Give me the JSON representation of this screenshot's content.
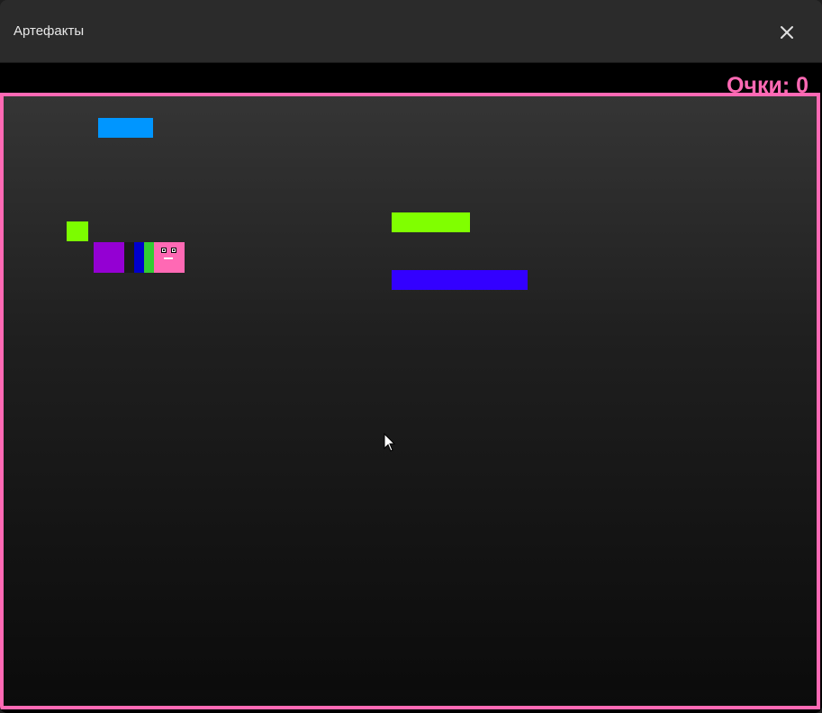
{
  "window": {
    "title": "Артефакты",
    "close_icon": "close-icon"
  },
  "game": {
    "score_text": "Очки: 0",
    "score_label": "Очки",
    "score_value": 0,
    "colors": {
      "accent": "#ff69b4",
      "snake_head": "#ff69b4",
      "snake_segments": [
        "#9400d3",
        "#0000cd",
        "#32cd32"
      ],
      "food_green": "#7cfc00",
      "platform_blue": "#0096ff",
      "platform_lime": "#80ff00",
      "platform_indigo": "#3300ff"
    }
  }
}
